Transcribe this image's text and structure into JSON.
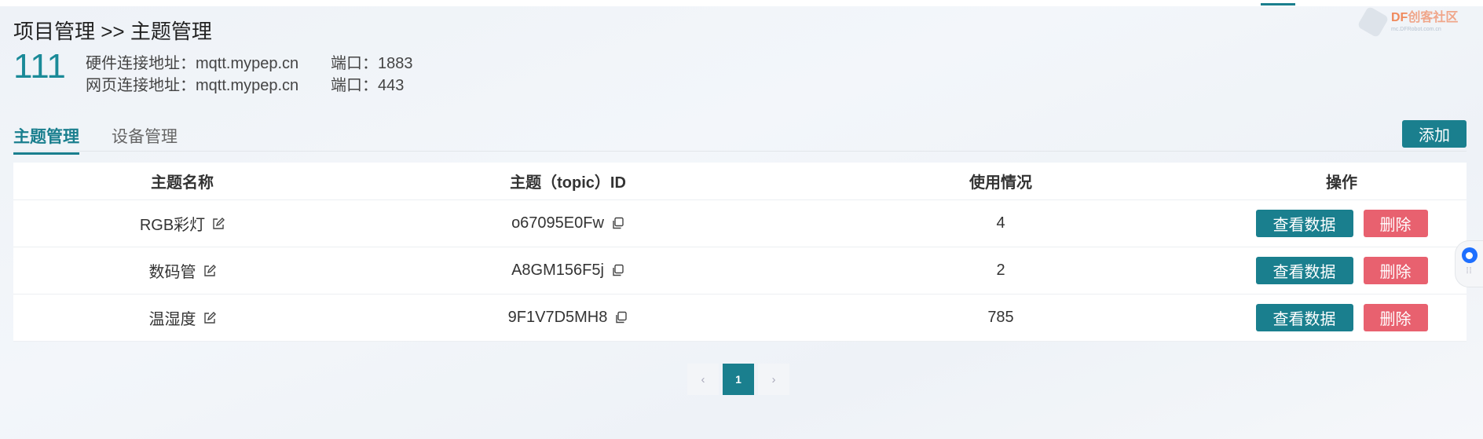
{
  "breadcrumb": "项目管理 >> 主题管理",
  "project": {
    "id": "111",
    "hardware_label": "硬件连接地址：mqtt.mypep.cn",
    "hardware_port": "端口：1883",
    "web_label": "网页连接地址：mqtt.mypep.cn",
    "web_port": "端口：443"
  },
  "tabs": [
    {
      "label": "主题管理",
      "active": true
    },
    {
      "label": "设备管理",
      "active": false
    }
  ],
  "add_button": "添加",
  "table": {
    "headers": [
      "主题名称",
      "主题（topic）ID",
      "使用情况",
      "操作"
    ],
    "rows": [
      {
        "name": "RGB彩灯",
        "topic_id": "o67095E0Fw",
        "usage": "4",
        "view_label": "查看数据",
        "delete_label": "删除"
      },
      {
        "name": "数码管",
        "topic_id": "A8GM156F5j",
        "usage": "2",
        "view_label": "查看数据",
        "delete_label": "删除"
      },
      {
        "name": "温湿度",
        "topic_id": "9F1V7D5MH8",
        "usage": "785",
        "view_label": "查看数据",
        "delete_label": "删除"
      }
    ]
  },
  "pagination": {
    "prev": "‹",
    "current": "1",
    "next": "›"
  },
  "watermark": {
    "brand_df": "DF",
    "brand_text": "创客社区",
    "url": "mc.DFRobot.com.cn"
  },
  "colors": {
    "accent": "#1a7f8e",
    "danger": "#e8616f",
    "widget_blue": "#1e6fff"
  },
  "icons": {
    "edit": "edit-icon",
    "copy": "copy-icon"
  }
}
